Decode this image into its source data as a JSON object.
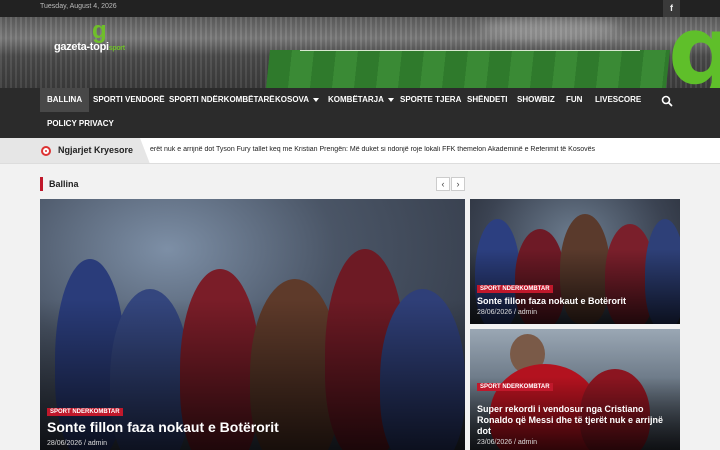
{
  "topbar": {
    "date": "Tuesday, August 4, 2026",
    "facebook_icon": "f"
  },
  "brand": {
    "logo_g": "g",
    "name_main": "gazeta-topi",
    "name_sport": "sport",
    "watermark_g": "g",
    "accent": "#6fbf2a"
  },
  "nav": {
    "items": [
      {
        "label": "BALLINA",
        "active": true
      },
      {
        "label": "SPORTI VENDORË"
      },
      {
        "label": "SPORTI NDËRKOMBËTARË"
      },
      {
        "label": "KOSOVA",
        "dropdown": true
      },
      {
        "label": "KOMBËTARJA",
        "dropdown": true
      },
      {
        "label": "SPORTE TJERA"
      },
      {
        "label": "SHËNDETI"
      },
      {
        "label": "SHOWBIZ"
      },
      {
        "label": "FUN"
      },
      {
        "label": "LIVESCORE"
      },
      {
        "label": "POLICY PRIVACY"
      }
    ],
    "search_icon": "search-icon"
  },
  "ticker": {
    "title": "Ngjarjet Kryesore",
    "items": [
      "erët nuk e arrijnë dot",
      "Tyson Fury tallet keq me Kristian Prengën: Më duket si ndonjë roje lokali",
      "FFK themelon Akademinë e Referimit të Kosovës"
    ]
  },
  "section": {
    "title": "Ballina",
    "prev_icon": "‹",
    "next_icon": "›"
  },
  "posts": {
    "main": {
      "category": "SPORT NDERKOMBTAR",
      "title": "Sonte fillon faza nokaut e Botërorit",
      "date": "28/06/2026",
      "author": "admin"
    },
    "side1": {
      "category": "SPORT NDERKOMBTAR",
      "title": "Sonte fillon faza nokaut e Botërorit",
      "date": "28/06/2026",
      "author": "admin"
    },
    "side2": {
      "category": "SPORT NDERKOMBTAR",
      "title": "Super rekordi i vendosur nga Cristiano Ronaldo që Messi dhe të tjerët nuk e arrijnë dot",
      "date": "23/06/2026",
      "author": "admin"
    }
  },
  "colors": {
    "brand_red": "#c0182b",
    "nav_bg": "#2b2b2b",
    "topbar_bg": "#222222"
  }
}
